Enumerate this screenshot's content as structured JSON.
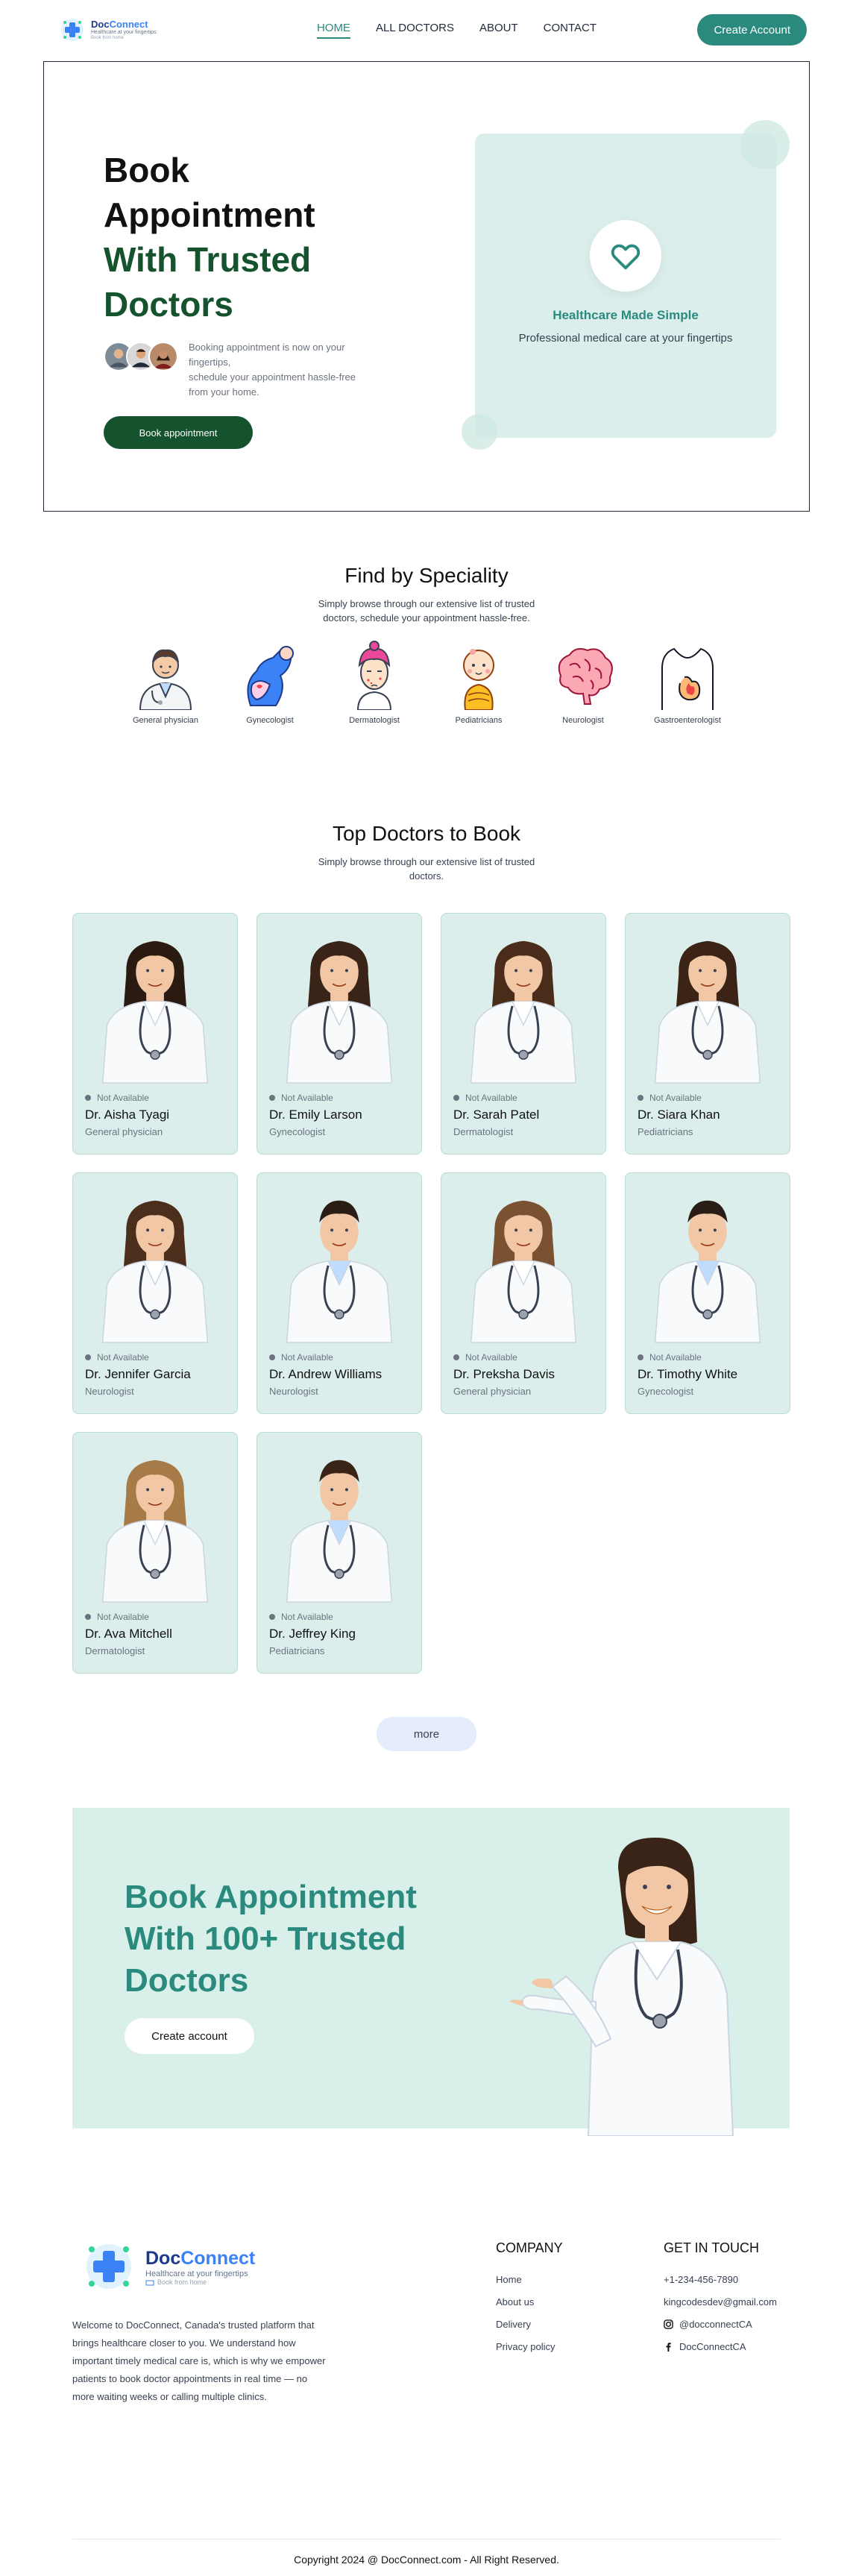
{
  "nav": {
    "brand_name_1": "Doc",
    "brand_name_2": "Connect",
    "brand_tagline": "Healthcare at your fingertips",
    "brand_sub": "Book from home",
    "links": [
      "HOME",
      "ALL DOCTORS",
      "ABOUT",
      "CONTACT"
    ],
    "active_link": "HOME",
    "create_account": "Create Account"
  },
  "hero": {
    "title_line1": "Book",
    "title_line2": "Appointment",
    "title_line3": "With Trusted",
    "title_line4": "Doctors",
    "description_line1": "Booking appointment is now on your fingertips,",
    "description_line2": "schedule your appointment hassle-free from your home.",
    "button": "Book appointment",
    "card_title": "Healthcare Made Simple",
    "card_subtitle": "Professional medical care at your fingertips"
  },
  "speciality": {
    "title": "Find by Speciality",
    "subtitle": "Simply browse through our extensive list of trusted doctors, schedule your appointment hassle-free.",
    "items": [
      {
        "label": "General physician",
        "icon": "general-physician-icon"
      },
      {
        "label": "Gynecologist",
        "icon": "gynecologist-icon"
      },
      {
        "label": "Dermatologist",
        "icon": "dermatologist-icon"
      },
      {
        "label": "Pediatricians",
        "icon": "pediatrician-icon"
      },
      {
        "label": "Neurologist",
        "icon": "neurologist-icon"
      },
      {
        "label": "Gastroenterologist",
        "icon": "gastroenterologist-icon"
      }
    ]
  },
  "doctors": {
    "title": "Top Doctors to Book",
    "subtitle": "Simply browse through our extensive list of trusted doctors.",
    "list": [
      {
        "status": "Not Available",
        "name": "Dr. Aisha Tyagi",
        "speciality": "General physician",
        "gender": "f",
        "hair": "#2b1a12"
      },
      {
        "status": "Not Available",
        "name": "Dr. Emily Larson",
        "speciality": "Gynecologist",
        "gender": "f",
        "hair": "#3a2418"
      },
      {
        "status": "Not Available",
        "name": "Dr. Sarah Patel",
        "speciality": "Dermatologist",
        "gender": "f",
        "hair": "#4a2c1a"
      },
      {
        "status": "Not Available",
        "name": "Dr. Siara Khan",
        "speciality": "Pediatricians",
        "gender": "f",
        "hair": "#3b2316"
      },
      {
        "status": "Not Available",
        "name": "Dr. Jennifer Garcia",
        "speciality": "Neurologist",
        "gender": "f",
        "hair": "#4b2e1c"
      },
      {
        "status": "Not Available",
        "name": "Dr. Andrew Williams",
        "speciality": "Neurologist",
        "gender": "m",
        "hair": "#2a1d16"
      },
      {
        "status": "Not Available",
        "name": "Dr. Preksha Davis",
        "speciality": "General physician",
        "gender": "f",
        "hair": "#7a5232"
      },
      {
        "status": "Not Available",
        "name": "Dr. Timothy White",
        "speciality": "Gynecologist",
        "gender": "m",
        "hair": "#2a1d16"
      },
      {
        "status": "Not Available",
        "name": "Dr. Ava Mitchell",
        "speciality": "Dermatologist",
        "gender": "f",
        "hair": "#a77b48"
      },
      {
        "status": "Not Available",
        "name": "Dr. Jeffrey King",
        "speciality": "Pediatricians",
        "gender": "m",
        "hair": "#3a2418"
      }
    ],
    "more": "more"
  },
  "cta": {
    "title_line1": "Book Appointment",
    "title_line2": "With 100+ Trusted",
    "title_line3": "Doctors",
    "button": "Create account"
  },
  "footer": {
    "brand_name_1": "Doc",
    "brand_name_2": "Connect",
    "tagline": "Healthcare at your fingertips",
    "sub": "Book from home",
    "about": "Welcome to DocConnect, Canada's trusted platform that brings healthcare closer to you. We understand how important timely medical care is, which is why we empower patients to book doctor appointments in real time — no more waiting weeks or calling multiple clinics.",
    "company_title": "COMPANY",
    "company_links": [
      "Home",
      "About us",
      "Delivery",
      "Privacy policy"
    ],
    "contact_title": "GET IN TOUCH",
    "phone": "+1-234-456-7890",
    "email": "kingcodesdev@gmail.com",
    "instagram": "@docconnectCA",
    "facebook": "DocConnectCA",
    "copyright": "Copyright 2024 @ DocConnect.com - All Right Reserved."
  },
  "colors": {
    "primary": "#2a8a7d",
    "dark_green": "#14532d",
    "card_bg": "#dbeeeb",
    "brand_blue": "#1e3a8a"
  }
}
